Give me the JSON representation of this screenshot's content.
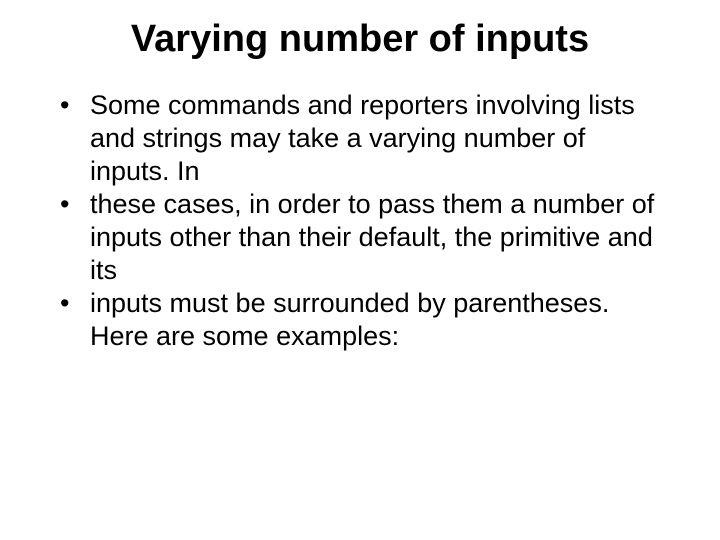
{
  "slide": {
    "title": "Varying number of inputs",
    "bullets": [
      "Some commands and reporters involving lists and strings may take a varying number of inputs. In",
      "these cases, in order to pass them a number of inputs other than their default, the primitive and its",
      "inputs must be surrounded by parentheses. Here are some examples:"
    ]
  }
}
